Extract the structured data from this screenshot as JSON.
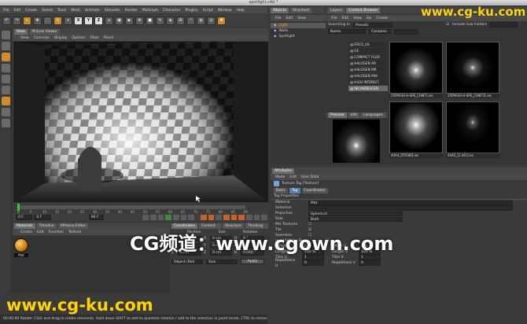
{
  "window": {
    "title": "spotlight.c4d *"
  },
  "menu": [
    "File",
    "Edit",
    "Create",
    "Select",
    "Tools",
    "Mesh",
    "Animate",
    "Simulate",
    "Render",
    "MoGraph",
    "Character",
    "Plugins",
    "Script",
    "Window",
    "Help"
  ],
  "toolbar": {
    "axis_x": "X",
    "axis_y": "Y",
    "axis_z": "Z"
  },
  "viewport": {
    "tabs": [
      "View",
      "Picture Viewer"
    ],
    "menu": [
      "View",
      "Cameras",
      "Display",
      "Options",
      "Filter",
      "Panel"
    ]
  },
  "timeline": {
    "ticks": [
      "0",
      "5",
      "10",
      "15",
      "20",
      "25",
      "30",
      "35",
      "40",
      "45",
      "50",
      "55",
      "60",
      "65",
      "70",
      "75",
      "80",
      "85",
      "90"
    ],
    "end_field": "0 F",
    "start_field": "0 F",
    "min_field": "0 F",
    "max_field": "90 F"
  },
  "materials": {
    "tabs": [
      "Materials",
      "Timeline",
      "XPresso Editor"
    ],
    "menu": [
      "Create",
      "Edit",
      "Function",
      "Texture"
    ],
    "item_label": "Mat"
  },
  "coordinates": {
    "tabs": [
      "Coordinates",
      "Content Browser",
      "Structure",
      "Thinking Particles"
    ],
    "headers": [
      "Position",
      "Size",
      "Rotation"
    ],
    "rows": [
      {
        "axis": "X",
        "pos": "0 cm",
        "size": "0 cm",
        "rot_label": "H",
        "rot": "0 °"
      },
      {
        "axis": "Y",
        "pos": "0 cm",
        "size": "0 cm",
        "rot_label": "P",
        "rot": "0 °"
      },
      {
        "axis": "Z",
        "pos": "0 cm",
        "size": "0 cm",
        "rot_label": "B",
        "rot": "0.016 °"
      }
    ],
    "mode": "Object (Rel)",
    "size_mode": "Size",
    "apply": "Apply"
  },
  "status": "00:00:00  Rotate: Click and drag to rotate elements. Hold down SHIFT to add to quantize rotation / add to the selection in point mode, CTRL to remove.",
  "objects": {
    "tabs": [
      "Objects",
      "Structure"
    ],
    "menu": [
      "File",
      "Edit",
      "View"
    ],
    "items": [
      {
        "name": "Light",
        "selected": true
      },
      {
        "name": "Walls",
        "selected": false
      },
      {
        "name": "Spotlight",
        "selected": false
      }
    ]
  },
  "browser": {
    "tabs": [
      "Layers",
      "Content Browser"
    ],
    "menu": [
      "File",
      "Edit",
      "View",
      "Go",
      "Create"
    ],
    "searching_label": "Searching in",
    "location": "Presets",
    "include_sub": "Include Sub-Folders",
    "name_col": "Name",
    "contains": "Contains",
    "tree": [
      {
        "name": "ERCO_US",
        "selected": false
      },
      {
        "name": "GE",
        "selected": false
      },
      {
        "name": "COMPACT FLUO",
        "selected": false
      },
      {
        "name": "HALOGEN AR",
        "selected": false
      },
      {
        "name": "HALOGEN MR",
        "selected": false
      },
      {
        "name": "HALOGEN PAR",
        "selected": false
      },
      {
        "name": "HIGH INTENSIT",
        "selected": false
      },
      {
        "name": "INCANDESCEN",
        "selected": true
      }
    ],
    "thumbs": [
      "25PAR30-H-SPE_[1987].ies",
      "25PAR30-H-SPE_[1987]1.ies",
      "40A4_[95588].ies",
      "44A5_[2.44]].ies"
    ],
    "preview_tabs": [
      "Preview",
      "Info",
      "Languages"
    ]
  },
  "attributes": {
    "tabs": [
      "Attributes"
    ],
    "menu": [
      "Mode",
      "Edit",
      "User Data"
    ],
    "title": "Texture Tag [Texture]",
    "subtabs": [
      "Basic",
      "Tag",
      "Coordinates"
    ],
    "section": "Tag Properties",
    "material_label": "Material",
    "material_value": "Mat",
    "selection_label": "Selection",
    "projection_label": "Projection",
    "projection_value": "Spherical",
    "side_label": "Side",
    "side_value": "Both",
    "mix_label": "Mix Textures",
    "tile_label": "Tile",
    "seamless_label": "Seamless",
    "uvw_label": "Use UVW for Bump",
    "offset_u": "Offset U",
    "offset_u_val": "0 %",
    "offset_v": "Offset V",
    "offset_v_val": "0 %",
    "length_u": "Length U",
    "length_u_val": "100 %",
    "length_v": "Length V",
    "length_v_val": "100 %",
    "tiles_u": "Tiles U",
    "tiles_u_val": "1",
    "tiles_v": "Tiles V",
    "tiles_v_val": "1",
    "rep_u": "Repetitions U",
    "rep_u_val": "0",
    "rep_v": "Repetitions V",
    "rep_v_val": "0"
  },
  "watermarks": {
    "top": "www.cg-ku.com",
    "center": "CG频道：www.cgown.com",
    "bottom": "www.cg-ku.com"
  },
  "colors": {
    "accent": "#f4a400",
    "watermark": "#ffd400"
  }
}
